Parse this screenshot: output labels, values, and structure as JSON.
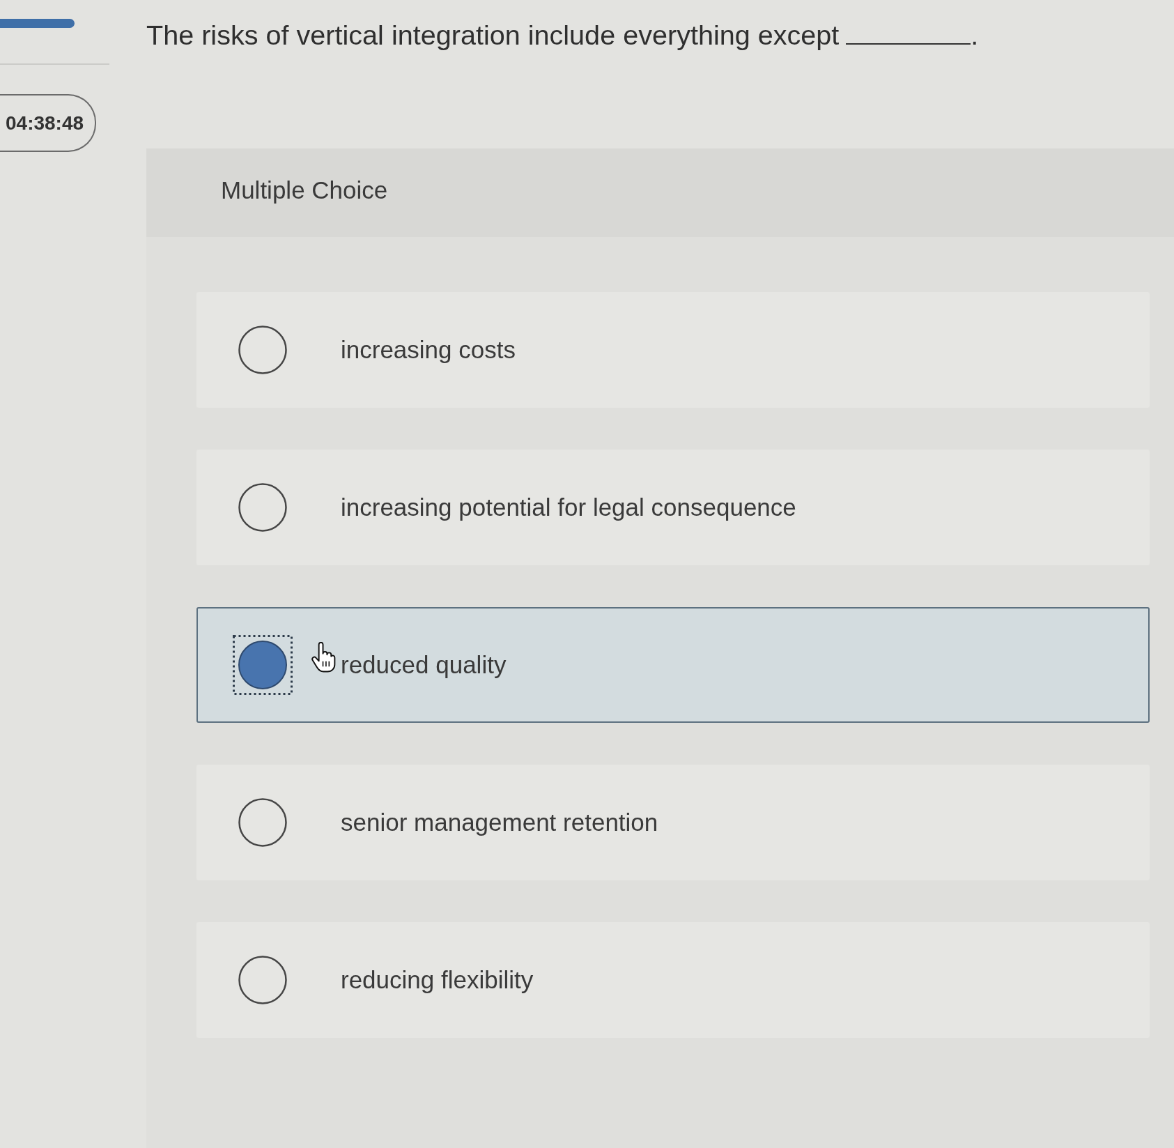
{
  "timer": "04:38:48",
  "question": {
    "text": "The risks of vertical integration include everything except",
    "end": "."
  },
  "question_type": "Multiple Choice",
  "options": [
    {
      "label": "increasing costs",
      "selected": false,
      "hovered": false
    },
    {
      "label": "increasing potential for legal consequence",
      "selected": false,
      "hovered": false
    },
    {
      "label": "reduced quality",
      "selected": true,
      "hovered": true
    },
    {
      "label": "senior management retention",
      "selected": false,
      "hovered": false
    },
    {
      "label": "reducing flexibility",
      "selected": false,
      "hovered": false
    }
  ]
}
